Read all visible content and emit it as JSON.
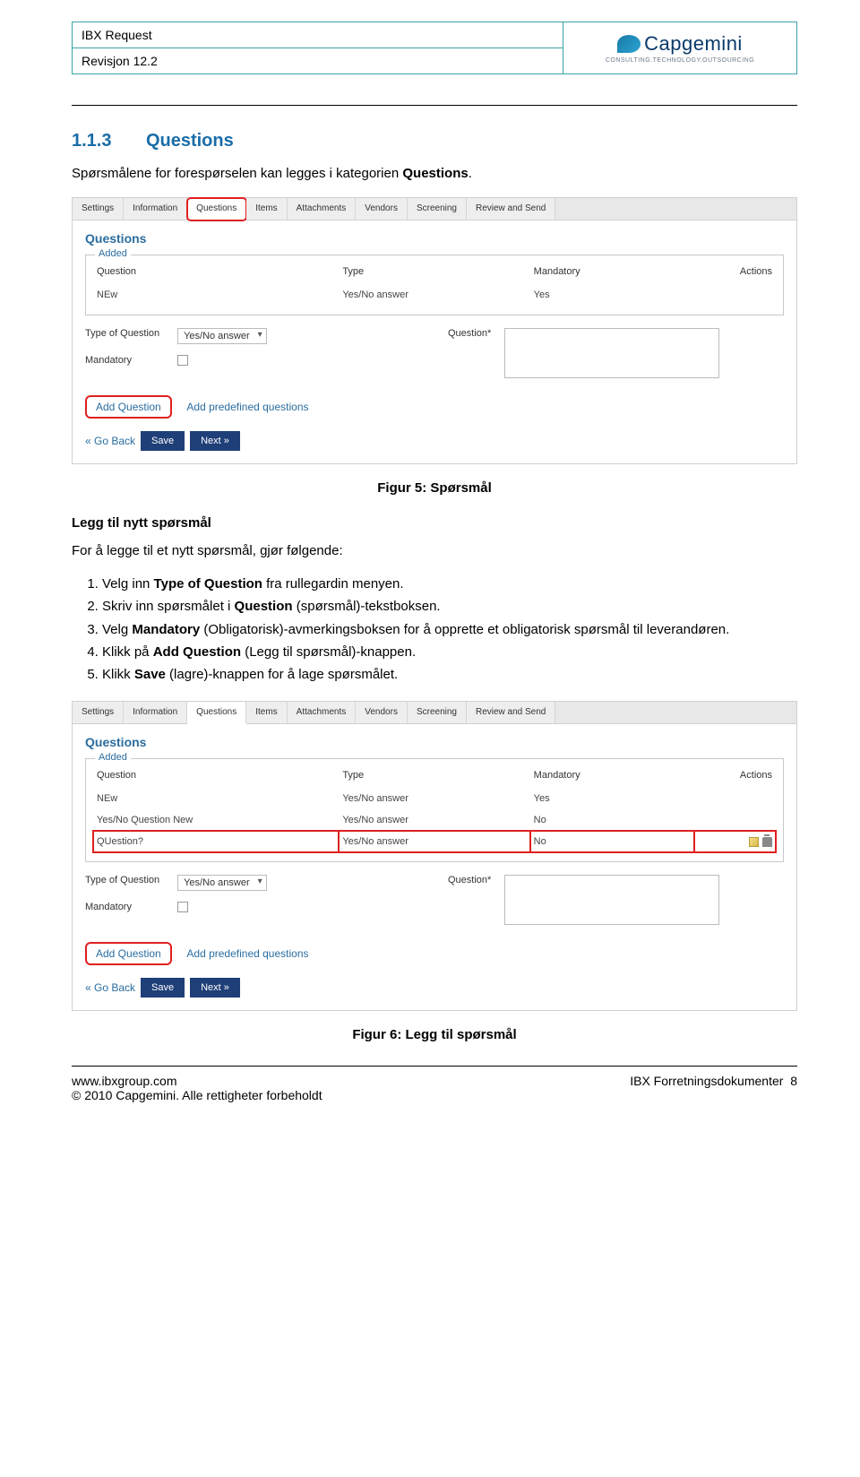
{
  "header": {
    "title": "IBX Request",
    "revision": "Revisjon 12.2",
    "logo_text": "Capgemini",
    "logo_sub": "CONSULTING.TECHNOLOGY.OUTSOURCING"
  },
  "section": {
    "num": "1.1.3",
    "title": "Questions",
    "intro_pre": "Spørsmålene for forespørselen kan legges i kategorien ",
    "intro_bold": "Questions",
    "intro_post": "."
  },
  "shot_common": {
    "tabs": [
      "Settings",
      "Information",
      "Questions",
      "Items",
      "Attachments",
      "Vendors",
      "Screening",
      "Review and Send"
    ],
    "active_tab_index": 2,
    "heading": "Questions",
    "legend": "Added",
    "cols": {
      "q": "Question",
      "t": "Type",
      "m": "Mandatory",
      "a": "Actions"
    },
    "form": {
      "type_label": "Type of Question",
      "type_value": "Yes/No answer",
      "mand_label": "Mandatory",
      "q_label": "Question*",
      "add_btn": "Add Question",
      "predef": "Add predefined questions",
      "goback": "« Go Back",
      "save": "Save",
      "next": "Next »"
    }
  },
  "shot1": {
    "highlight_tab": true,
    "rows": [
      {
        "q": "NEw",
        "t": "Yes/No answer",
        "m": "Yes",
        "icons": false,
        "hl": false
      }
    ]
  },
  "caption1": "Figur 5: Spørsmål",
  "instr": {
    "h": "Legg til nytt spørsmål",
    "lead": "For å legge til et nytt spørsmål, gjør følgende:",
    "items": [
      {
        "pre": "Velg inn ",
        "b": "Type of Question",
        "post": " fra rullegardin menyen."
      },
      {
        "pre": "Skriv inn spørsmålet i ",
        "b": "Question",
        "post": " (spørsmål)-tekstboksen."
      },
      {
        "pre": "Velg ",
        "b": "Mandatory",
        "post": " (Obligatorisk)-avmerkingsboksen for å opprette et obligatorisk spørsmål til leverandøren."
      },
      {
        "pre": "Klikk på ",
        "b": "Add Question",
        "post": " (Legg til spørsmål)-knappen."
      },
      {
        "pre": "Klikk ",
        "b": "Save",
        "post": " (lagre)-knappen for å lage spørsmålet."
      }
    ]
  },
  "shot2": {
    "highlight_tab": false,
    "rows": [
      {
        "q": "NEw",
        "t": "Yes/No answer",
        "m": "Yes",
        "icons": false,
        "hl": false
      },
      {
        "q": "Yes/No Question New",
        "t": "Yes/No answer",
        "m": "No",
        "icons": false,
        "hl": false
      },
      {
        "q": "QUestion?",
        "t": "Yes/No answer",
        "m": "No",
        "icons": true,
        "hl": true
      }
    ]
  },
  "caption2": "Figur 6: Legg til spørsmål",
  "footer": {
    "url": "www.ibxgroup.com",
    "copy": "© 2010 Capgemini. Alle rettigheter forbeholdt",
    "right": "IBX Forretningsdokumenter",
    "page": "8"
  }
}
